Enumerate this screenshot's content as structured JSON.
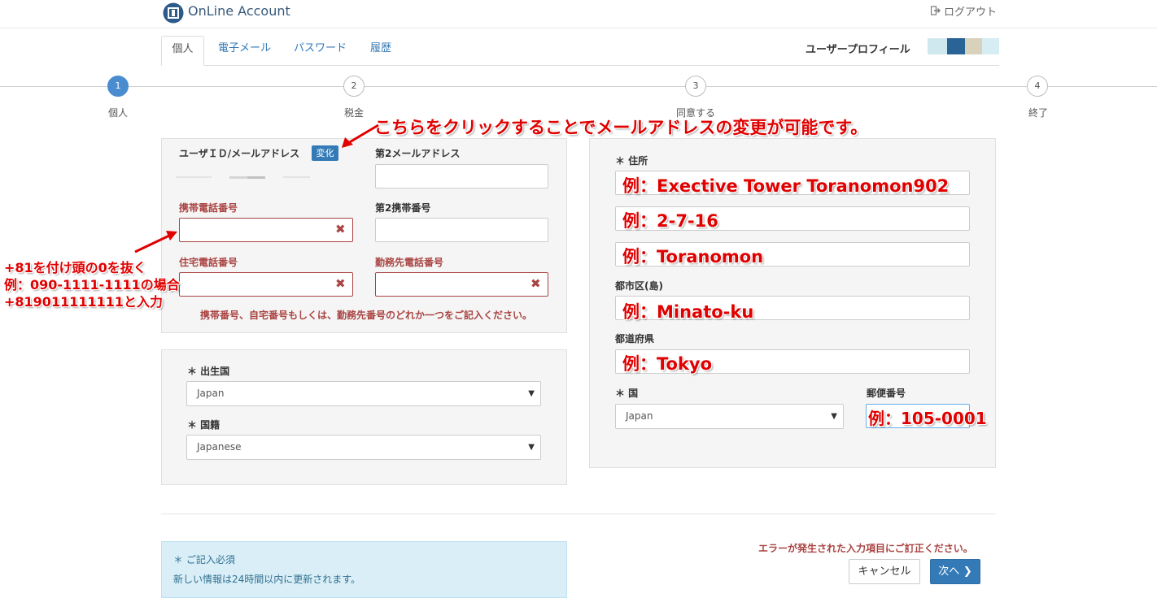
{
  "header": {
    "app_title": "OnLine Account",
    "logout_label": "ログアウト"
  },
  "tabs": [
    {
      "label": "個人",
      "active": true
    },
    {
      "label": "電子メール"
    },
    {
      "label": "パスワード"
    },
    {
      "label": "履歴"
    }
  ],
  "profile": {
    "label": "ユーザープロフィール",
    "bar_colors": [
      "#cfe8ef",
      "#2a6496",
      "#d8d2bc",
      "#d7edf4"
    ]
  },
  "steps": [
    {
      "number": "1",
      "label": "個人",
      "active": true
    },
    {
      "number": "2",
      "label": "税金"
    },
    {
      "number": "3",
      "label": "同意する"
    },
    {
      "number": "4",
      "label": "終了"
    }
  ],
  "contact": {
    "user_id_label": "ユーザＩＤ/メールアドレス",
    "change_button": "変化",
    "email2_label": "第2メールアドレス",
    "mobile_label": "携帯電話番号",
    "mobile2_label": "第2携帯番号",
    "home_phone_label": "住宅電話番号",
    "work_phone_label": "勤務先電話番号",
    "error_text": "携帯番号、自宅番号もしくは、勤務先番号のどれか一つをご記入ください。"
  },
  "origin": {
    "birth_country_label": "＊ 出生国",
    "birth_country_value": "Japan",
    "nationality_label": "＊ 国籍",
    "nationality_value": "Japanese"
  },
  "address": {
    "address_label": "＊ 住所",
    "line1_example": "例：Exective Tower Toranomon902",
    "line2_example": "例：2-7-16",
    "line3_example": "例：Toranomon",
    "city_label": "都市区(島)",
    "city_example": "例：Minato-ku",
    "prefecture_label": "都道府県",
    "prefecture_example": "例：Tokyo",
    "country_label": "＊ 国",
    "country_value": "Japan",
    "postal_label": "郵便番号",
    "postal_example": "例：105-0001"
  },
  "annotations": {
    "change_hint": "こちらをクリックすることでメールアドレスの変更が可能です。",
    "phone_hint_line1": "+81を付け頭の0を抜く",
    "phone_hint_line2": "例：090-1111-1111の場合",
    "phone_hint_line3": "+819011111111と入力"
  },
  "footer": {
    "required_note": "＊ ご記入必須",
    "update_note": "新しい情報は24時間以内に更新されます。",
    "error_message": "エラーが発生された入力項目にご訂正ください。",
    "cancel_button": "キャンセル",
    "next_button": "次へ"
  }
}
